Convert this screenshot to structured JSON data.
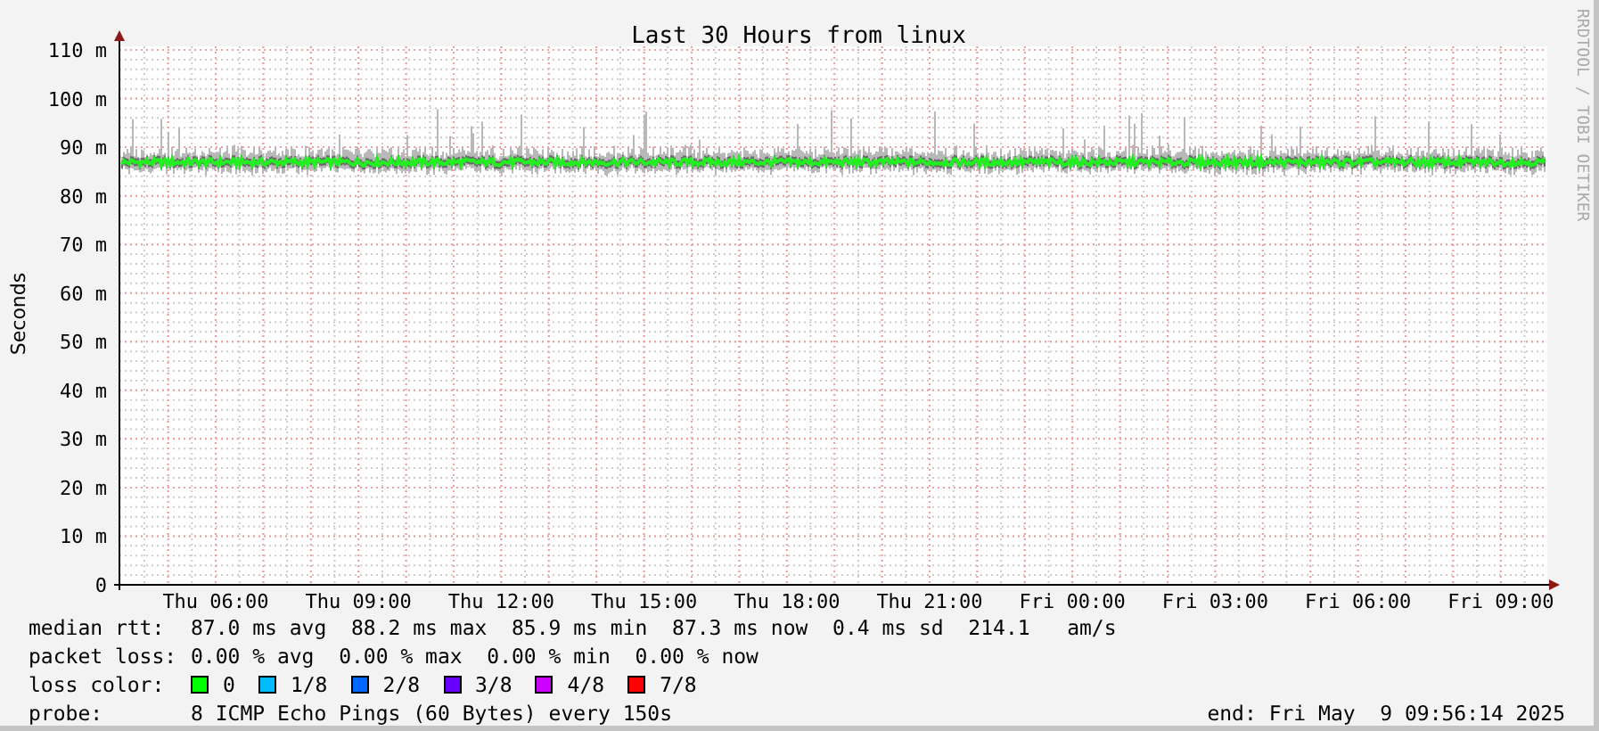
{
  "title": "Last 30 Hours from linux",
  "y_axis_label": "Seconds",
  "credit": "RRDTOOL / TOBI OETIKER",
  "y_ticks": [
    "110 m",
    "100 m",
    "90 m",
    "80 m",
    "70 m",
    "60 m",
    "50 m",
    "40 m",
    "30 m",
    "20 m",
    "10 m",
    "0"
  ],
  "x_ticks": [
    "Thu 06:00",
    "Thu 09:00",
    "Thu 12:00",
    "Thu 15:00",
    "Thu 18:00",
    "Thu 21:00",
    "Fri 00:00",
    "Fri 03:00",
    "Fri 06:00",
    "Fri 09:00"
  ],
  "legend": {
    "median_rtt": {
      "label": "median rtt:",
      "text": "87.0 ms avg  88.2 ms max  85.9 ms min  87.3 ms now  0.4 ms sd  214.1   am/s"
    },
    "packet_loss": {
      "label": "packet loss:",
      "text": "0.00 % avg  0.00 % max  0.00 % min  0.00 % now"
    },
    "loss_color_label": "loss color:",
    "loss_colors": [
      {
        "label": "0",
        "color": "#00ff00"
      },
      {
        "label": "1/8",
        "color": "#00bbff"
      },
      {
        "label": "2/8",
        "color": "#0066ff"
      },
      {
        "label": "3/8",
        "color": "#6600ff"
      },
      {
        "label": "4/8",
        "color": "#cc00ff"
      },
      {
        "label": "7/8",
        "color": "#ff0000"
      }
    ],
    "probe": {
      "label": "probe:",
      "text": "8 ICMP Echo Pings (60 Bytes) every 150s"
    },
    "end": "end: Fri May  9 09:56:14 2025"
  }
}
